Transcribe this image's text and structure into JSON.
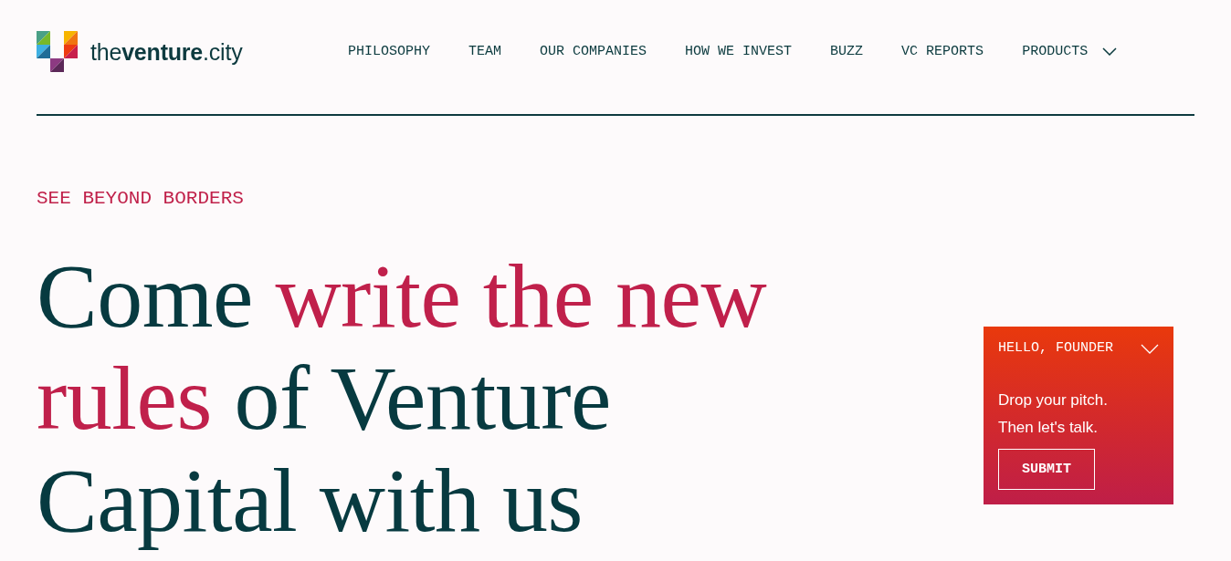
{
  "logo": {
    "text": "the**venture**.city"
  },
  "nav": [
    {
      "label": "PHILOSOPHY",
      "kind": "link"
    },
    {
      "label": "TEAM",
      "kind": "link"
    },
    {
      "label": "OUR COMPANIES",
      "kind": "link"
    },
    {
      "label": "HOW WE INVEST",
      "kind": "link"
    },
    {
      "label": "BUZZ",
      "kind": "link"
    },
    {
      "label": "VC REPORTS",
      "kind": "link"
    },
    {
      "label": "PRODUCTS",
      "kind": "dropdown"
    }
  ],
  "hero": {
    "eyebrow": "SEE BEYOND BORDERS",
    "headline": [
      {
        "text": "Come ",
        "highlight": false
      },
      {
        "text": "write the new rules",
        "highlight": true
      },
      {
        "text": " of Venture Capital with us",
        "highlight": false
      }
    ]
  },
  "pitch_card": {
    "title": "HELLO, FOUNDER",
    "message": "Drop your pitch. Then let's talk.",
    "button": "SUBMIT"
  }
}
